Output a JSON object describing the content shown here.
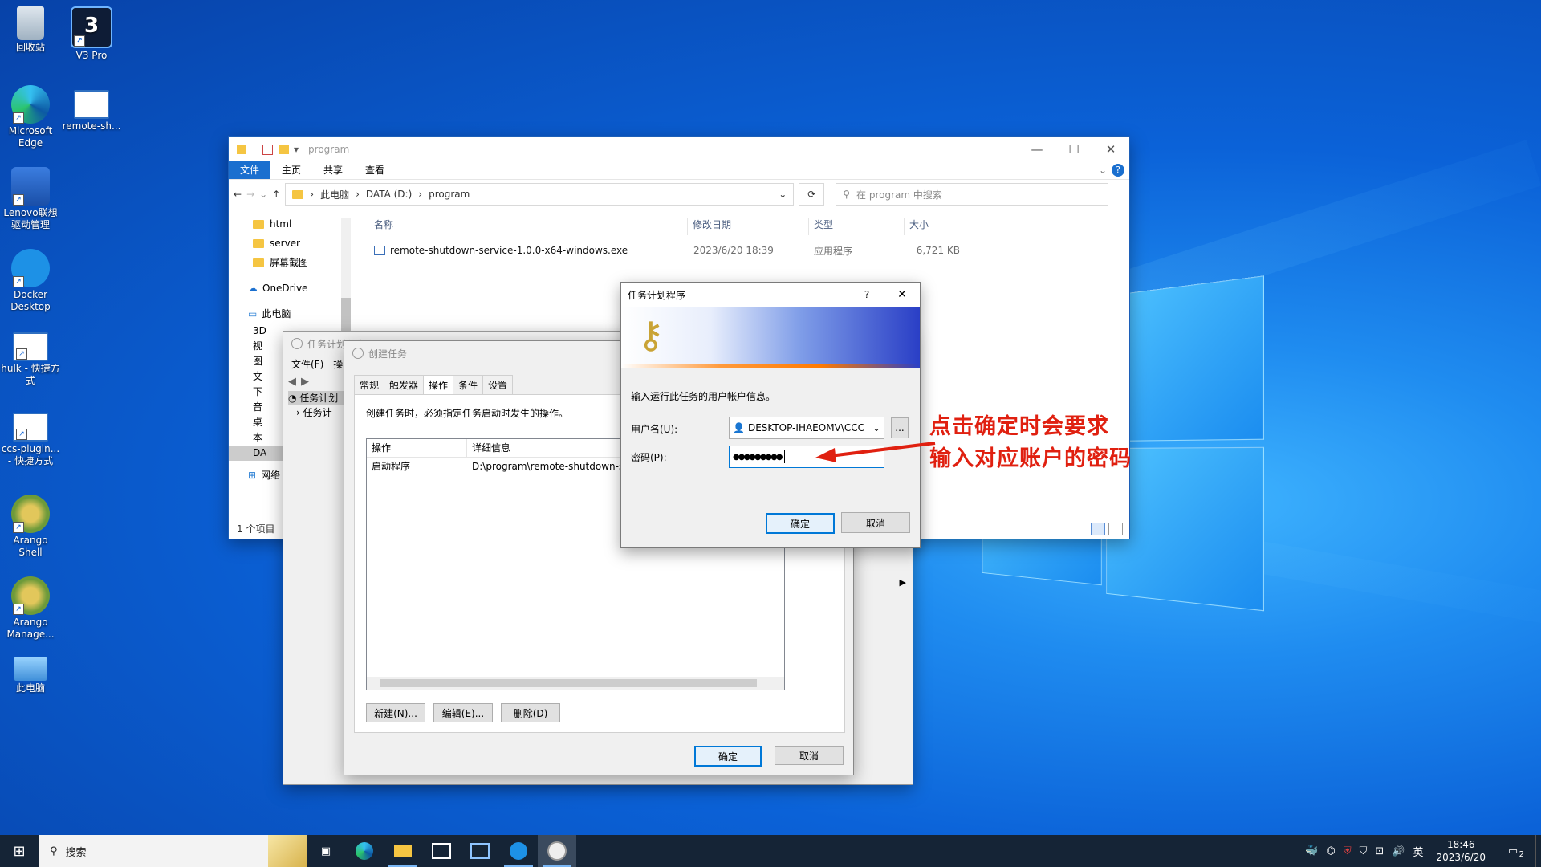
{
  "desktop": {
    "icons": [
      {
        "label": "回收站",
        "icon": "recycle-bin-icon"
      },
      {
        "label": "V3 Pro",
        "icon": "v3-pro-icon"
      },
      {
        "label": "Microsoft Edge",
        "icon": "edge-icon"
      },
      {
        "label": "remote-sh...",
        "icon": "app-window-icon"
      },
      {
        "label": "Lenovo联想驱动管理",
        "icon": "lenovo-driver-icon"
      },
      {
        "label": "Docker Desktop",
        "icon": "docker-icon"
      },
      {
        "label": "hulk - 快捷方式",
        "icon": "app-window-icon"
      },
      {
        "label": "ccs-plugin... - 快捷方式",
        "icon": "app-window-icon"
      },
      {
        "label": "Arango Shell",
        "icon": "arango-icon"
      },
      {
        "label": "Arango Manage...",
        "icon": "arango-icon"
      },
      {
        "label": "此电脑",
        "icon": "this-pc-icon"
      }
    ]
  },
  "explorer": {
    "title": "program",
    "ribbon": [
      "文件",
      "主页",
      "共享",
      "查看"
    ],
    "breadcrumb": [
      "此电脑",
      "DATA (D:)",
      "program"
    ],
    "search_placeholder": "在 program 中搜索",
    "nav": {
      "folders": [
        "html",
        "server",
        "屏幕截图"
      ],
      "onedrive": "OneDrive",
      "thispc": "此电脑",
      "pc_items": [
        "3D",
        "视",
        "图",
        "文",
        "下",
        "音",
        "桌",
        "本",
        "DA"
      ],
      "network": "网络"
    },
    "columns": [
      "名称",
      "修改日期",
      "类型",
      "大小"
    ],
    "files": [
      {
        "name": "remote-shutdown-service-1.0.0-x64-windows.exe",
        "date": "2023/6/20 18:39",
        "type": "应用程序",
        "size": "6,721 KB"
      }
    ],
    "status": "1 个项目"
  },
  "task_scheduler": {
    "title": "任务计划程序",
    "menu": [
      "文件(F)",
      "操"
    ],
    "tree": [
      "任务计划",
      "任务计"
    ]
  },
  "create_task": {
    "title": "创建任务",
    "tabs": [
      "常规",
      "触发器",
      "操作",
      "条件",
      "设置"
    ],
    "description": "创建任务时，必须指定任务启动时发生的操作。",
    "table_headers": [
      "操作",
      "详细信息"
    ],
    "rows": [
      {
        "action": "启动程序",
        "detail": "D:\\program\\remote-shutdown-se"
      }
    ],
    "buttons": {
      "new": "新建(N)...",
      "edit": "编辑(E)...",
      "delete": "删除(D)"
    },
    "ok": "确定",
    "cancel": "取消"
  },
  "auth_dialog": {
    "title": "任务计划程序",
    "help": "?",
    "instruction": "输入运行此任务的用户帐户信息。",
    "username_label": "用户名(U):",
    "username_value": "DESKTOP-IHAEOMV\\CCC",
    "browse": "...",
    "password_label": "密码(P):",
    "password_value": "●●●●●●●●●",
    "ok": "确定",
    "cancel": "取消"
  },
  "annotation": {
    "line1": "点击确定时会要求",
    "line2": "输入对应账户的密码",
    "color": "#e02010"
  },
  "taskbar": {
    "search_placeholder": "搜索",
    "ime": "英",
    "time": "18:46",
    "date": "2023/6/20",
    "notification_count": "2"
  }
}
